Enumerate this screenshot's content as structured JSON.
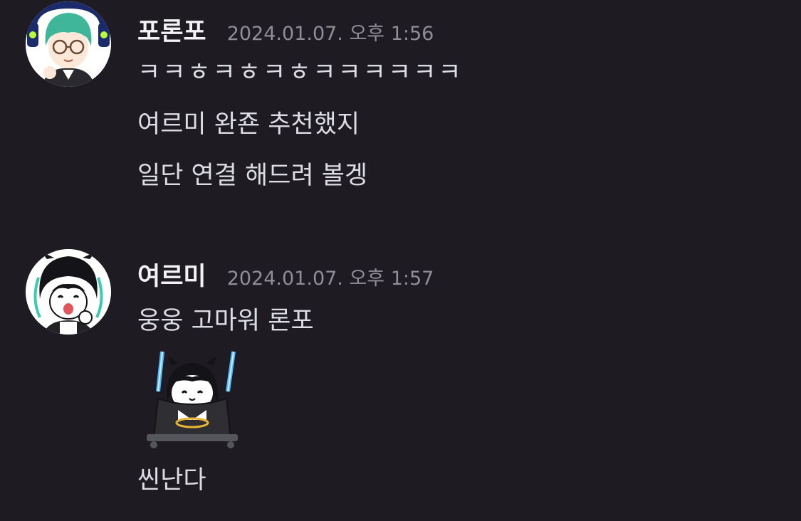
{
  "messages": [
    {
      "username": "포론포",
      "timestamp": "2024.01.07. 오후 1:56",
      "avatar_icon": "green-haired-character-avatar-icon",
      "lines": [
        "ㅋㅋㅎㅋㅎㅋㅎㅋㅋㅋㅋㅋㅋ",
        "여르미 완죤 추천했지",
        "일단 연결 해드려 볼겡"
      ]
    },
    {
      "username": "여르미",
      "timestamp": "2024.01.07. 오후 1:57",
      "avatar_icon": "black-haired-character-avatar-icon",
      "lines": [
        "웅웅 고마워 론포"
      ],
      "sticker_icon": "swing-character-sticker-icon",
      "after_sticker_lines": [
        "씬난다"
      ]
    }
  ],
  "colors": {
    "background": "#1e1b22",
    "username": "#f2f2f5",
    "timestamp": "#8e8d98",
    "message_text": "#dcdce4"
  }
}
